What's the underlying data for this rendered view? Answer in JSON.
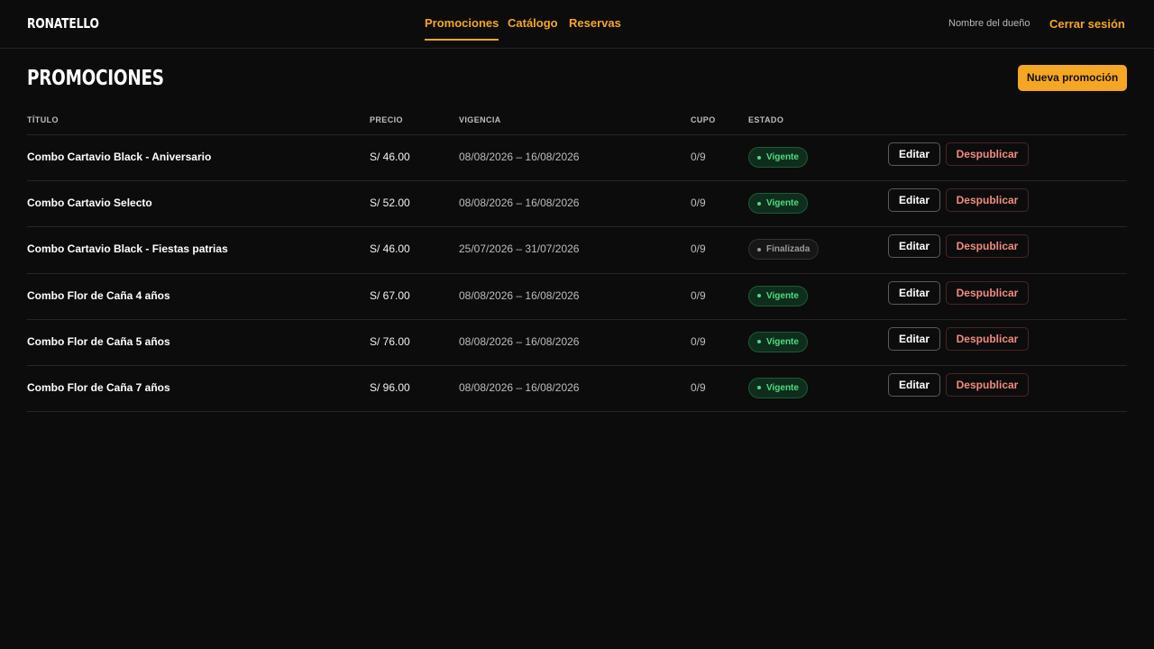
{
  "header": {
    "brand": "RONATELLO",
    "nav": [
      {
        "label": "Promociones",
        "active": true
      },
      {
        "label": "Catálogo",
        "active": false
      },
      {
        "label": "Reservas",
        "active": false
      }
    ],
    "owner_name": "Nombre del dueño",
    "logout_label": "Cerrar sesión"
  },
  "page": {
    "title": "PROMOCIONES",
    "new_button_label": "Nueva promoción"
  },
  "table": {
    "columns": [
      "TÍTULO",
      "PRECIO",
      "VIGENCIA",
      "CUPO",
      "ESTADO"
    ],
    "rows": [
      {
        "title": "Combo Cartavio Black - Aniversario",
        "price": "S/ 46.00",
        "dates": "08/08/2026 – 16/08/2026",
        "cupo": "0/9",
        "status": "Vigente",
        "status_type": "vigente"
      },
      {
        "title": "Combo Cartavio Selecto",
        "price": "S/ 52.00",
        "dates": "08/08/2026 – 16/08/2026",
        "cupo": "0/9",
        "status": "Vigente",
        "status_type": "vigente"
      },
      {
        "title": "Combo Cartavio Black - Fiestas patrias",
        "price": "S/ 46.00",
        "dates": "25/07/2026 – 31/07/2026",
        "cupo": "0/9",
        "status": "Finalizada",
        "status_type": "finalizada"
      },
      {
        "title": "Combo Flor de Caña 4 años",
        "price": "S/ 67.00",
        "dates": "08/08/2026 – 16/08/2026",
        "cupo": "0/9",
        "status": "Vigente",
        "status_type": "vigente"
      },
      {
        "title": "Combo Flor de Caña 5 años",
        "price": "S/ 76.00",
        "dates": "08/08/2026 – 16/08/2026",
        "cupo": "0/9",
        "status": "Vigente",
        "status_type": "vigente"
      },
      {
        "title": "Combo Flor de Caña 7 años",
        "price": "S/ 96.00",
        "dates": "08/08/2026 – 16/08/2026",
        "cupo": "0/9",
        "status": "Vigente",
        "status_type": "vigente"
      }
    ],
    "edit_label": "Editar",
    "unpublish_label": "Despublicar"
  },
  "colors": {
    "background": "#0c0c0c",
    "accent": "#f5a623",
    "status_active": "#4ade80",
    "danger": "#f28b82"
  }
}
